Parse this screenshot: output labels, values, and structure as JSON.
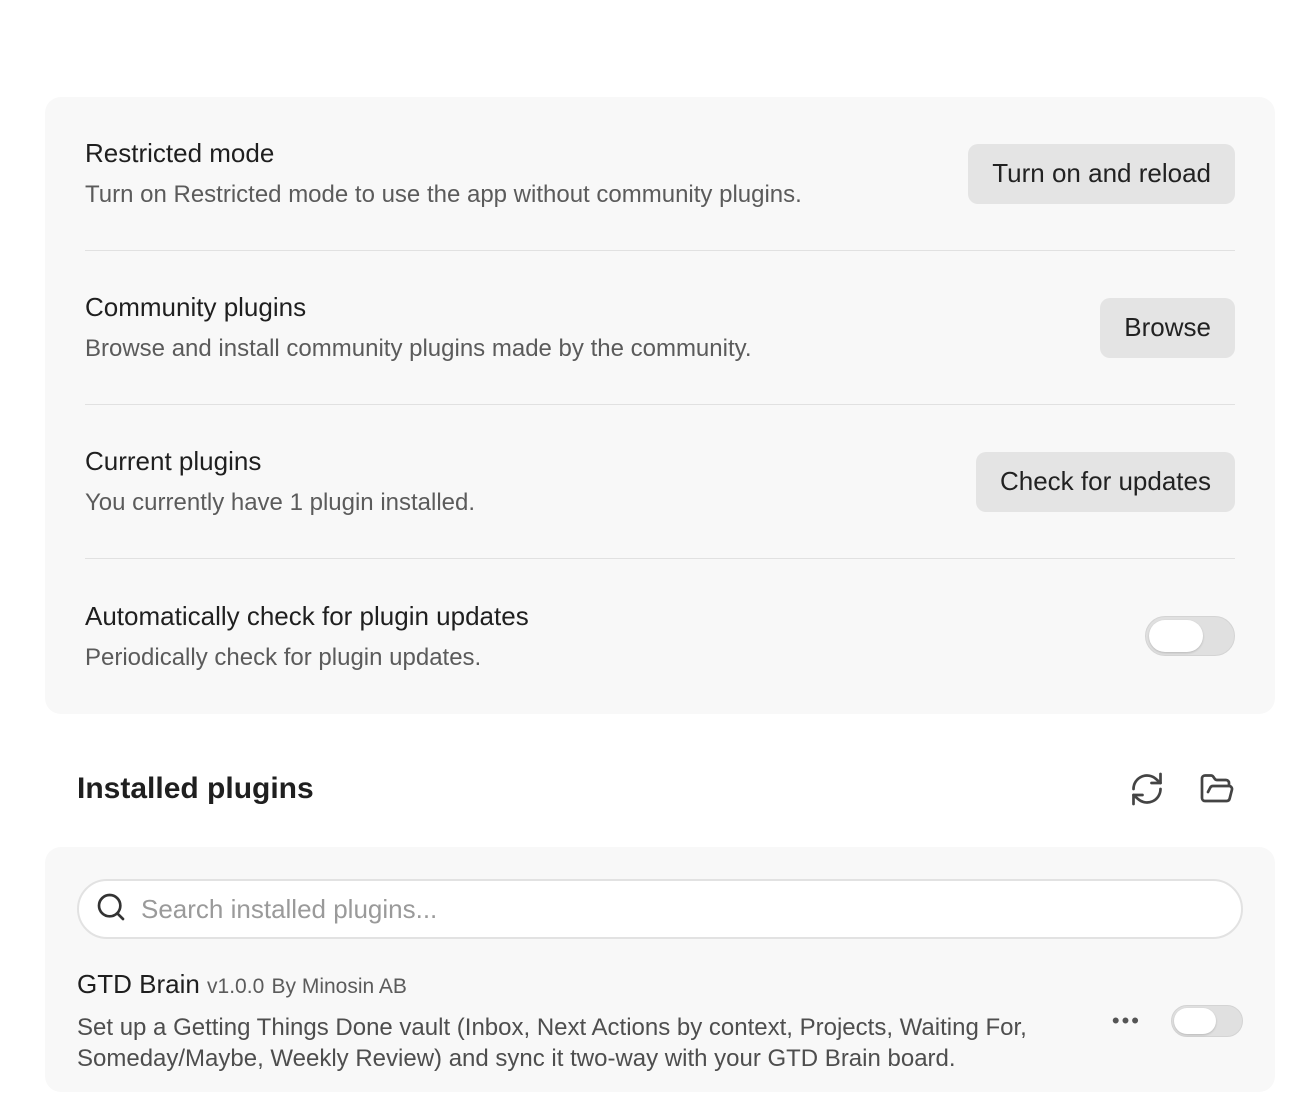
{
  "settings": [
    {
      "name": "Restricted mode",
      "description": "Turn on Restricted mode to use the app without community plugins.",
      "action": "Turn on and reload"
    },
    {
      "name": "Community plugins",
      "description": "Browse and install community plugins made by the community.",
      "action": "Browse"
    },
    {
      "name": "Current plugins",
      "description": "You currently have 1 plugin installed.",
      "action": "Check for updates"
    },
    {
      "name": "Automatically check for plugin updates",
      "description": "Periodically check for plugin updates.",
      "toggle_on": false
    }
  ],
  "installed": {
    "title": "Installed plugins",
    "icons": [
      "reload-icon",
      "folder-open-icon"
    ],
    "search_placeholder": "Search installed plugins...",
    "plugin": {
      "name": "GTD Brain",
      "version": "v1.0.0",
      "author": "By Minosin AB",
      "description": "Set up a Getting Things Done vault (Inbox, Next Actions by context, Projects, Waiting For, Someday/Maybe, Weekly Review) and sync it two-way with your GTD Brain board.",
      "options_icon": "more-horizontal-icon",
      "enabled": false
    }
  }
}
